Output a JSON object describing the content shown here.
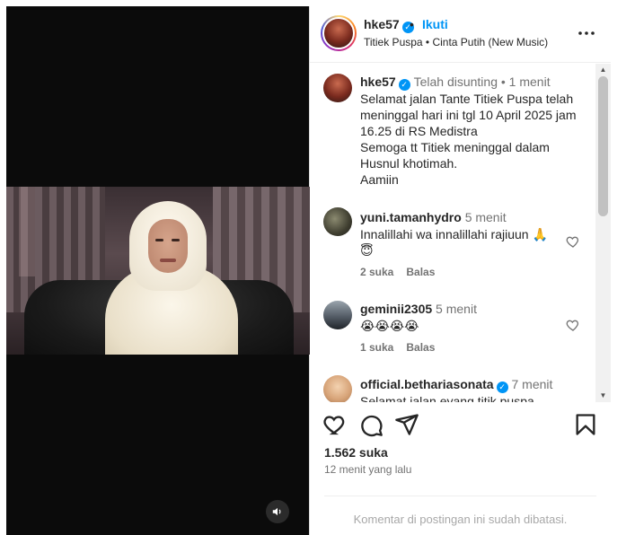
{
  "header": {
    "username": "hke57",
    "separator": "•",
    "follow_label": "Ikuti",
    "audio": "Titiek Puspa • Cinta Putih (New Music)"
  },
  "caption": {
    "username": "hke57",
    "meta": "Telah disunting • 1 menit",
    "lines": [
      "Selamat jalan Tante Titiek Puspa telah",
      "meninggal hari ini tgl 10 April 2025 jam",
      "16.25 di RS Medistra",
      "Semoga tt Titiek meninggal dalam",
      "Husnul khotimah.",
      "Aamiin"
    ]
  },
  "comments": [
    {
      "username": "yuni.tamanhydro",
      "time": "5 menit",
      "text_line1": "Innalillahi wa innalillahi rajiuun 🙏",
      "text_line2": "😇",
      "likes": "2 suka",
      "reply": "Balas"
    },
    {
      "username": "geminii2305",
      "time": "5 menit",
      "text_line1": "😭😭😭😭",
      "likes": "1 suka",
      "reply": "Balas"
    },
    {
      "username": "official.betharia­sonata",
      "time": "7 menit",
      "text_line1": "Selamat jalan eyang titik puspa"
    }
  ],
  "footer": {
    "likes": "1.562 suka",
    "time_ago": "12 menit yang lalu",
    "limited_comments": "Komentar di postingan ini sudah dibatasi."
  },
  "icons": {
    "like": "heart-icon",
    "comment": "comment-icon",
    "share": "share-icon",
    "save": "bookmark-icon",
    "more": "more-options-icon",
    "volume": "volume-icon"
  },
  "colors": {
    "accent": "#0095f6",
    "muted": "#737373",
    "text": "#262626"
  }
}
